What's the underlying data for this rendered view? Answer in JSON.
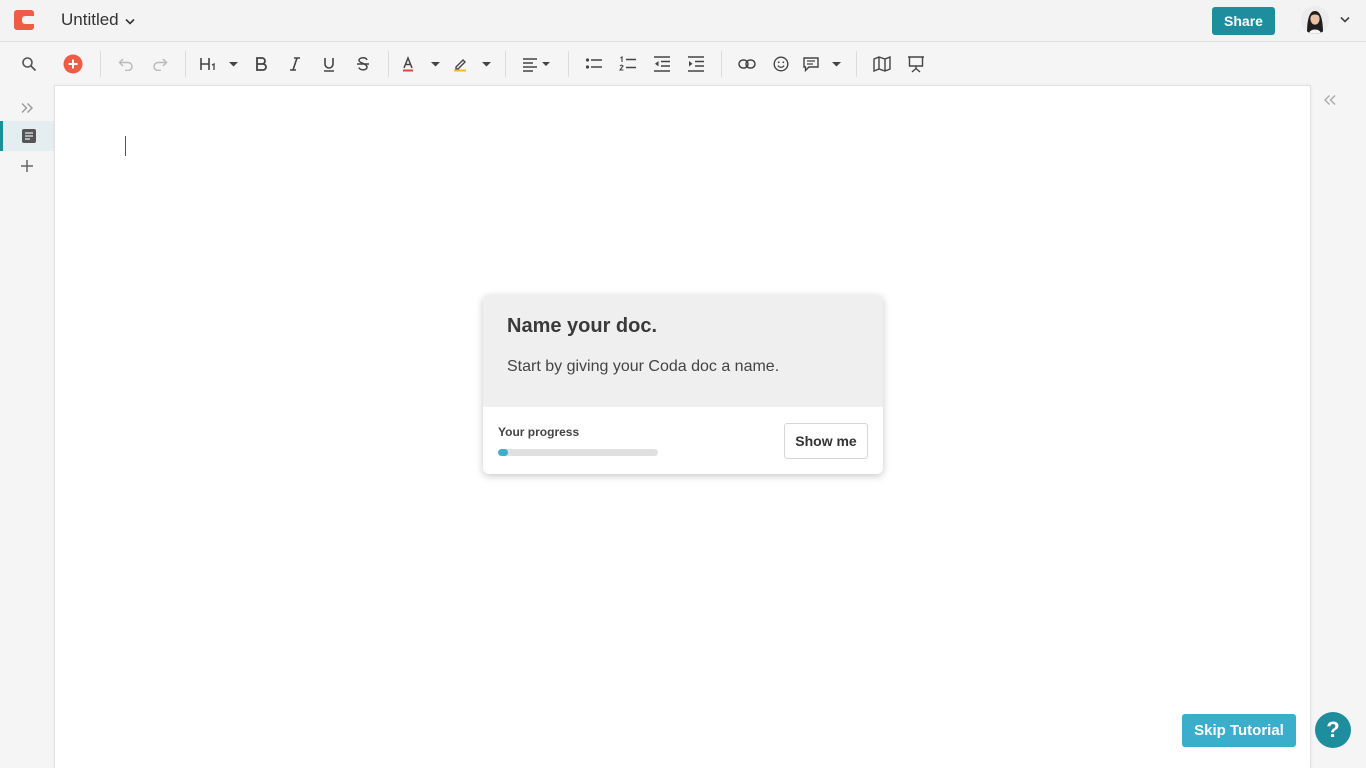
{
  "header": {
    "doc_title": "Untitled",
    "share_label": "Share",
    "accent_color": "#1e8d9e",
    "logo_color": "#ef5c46"
  },
  "toolbar": {
    "icons": [
      "search-icon",
      "insert-icon",
      "undo-icon",
      "redo-icon",
      "heading-icon",
      "bold-icon",
      "italic-icon",
      "underline-icon",
      "strikethrough-icon",
      "text-color-icon",
      "highlight-icon",
      "align-icon",
      "bulleted-list-icon",
      "numbered-list-icon",
      "outdent-icon",
      "indent-icon",
      "link-icon",
      "emoji-icon",
      "comment-icon",
      "map-icon",
      "presentation-icon"
    ]
  },
  "tour": {
    "heading": "Name your doc.",
    "body": "Start by giving your Coda doc a name.",
    "progress_label": "Your progress",
    "progress_fraction": 0.06,
    "show_me_label": "Show me"
  },
  "footer": {
    "skip_label": "Skip Tutorial",
    "help_label": "?"
  }
}
